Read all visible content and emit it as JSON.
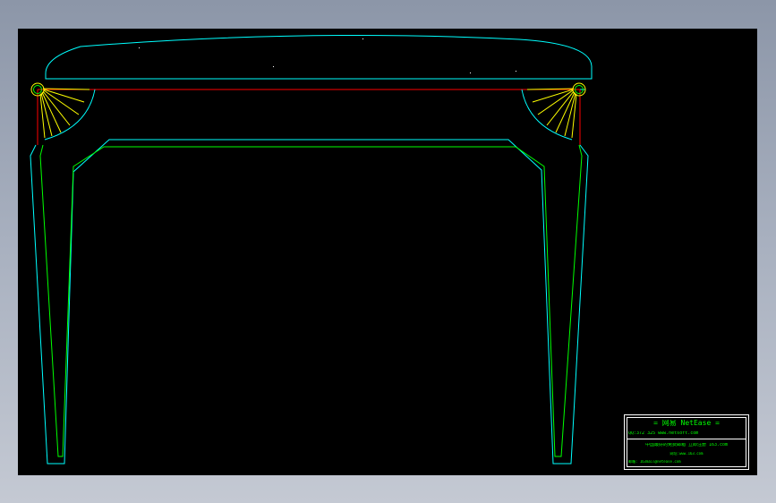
{
  "window": {
    "background": "#9aa3b3"
  },
  "viewport": {
    "background": "#000000"
  },
  "colors": {
    "top_outline": "#00ffff",
    "apron_line": "#ff0000",
    "fan_carving": "#ffff00",
    "inner_outline": "#00ff00",
    "title_frame": "#ffffff",
    "title_text": "#00ff00"
  },
  "title_block": {
    "brand": "= 网易 NetEase =",
    "contact": "QQ:372 325         www.netsoft.com",
    "line3": "中国最好的免费邮箱 立即注册 163.com",
    "line4": "网址:www.163.com",
    "line5": "邮箱: 163mail@netease.com"
  }
}
